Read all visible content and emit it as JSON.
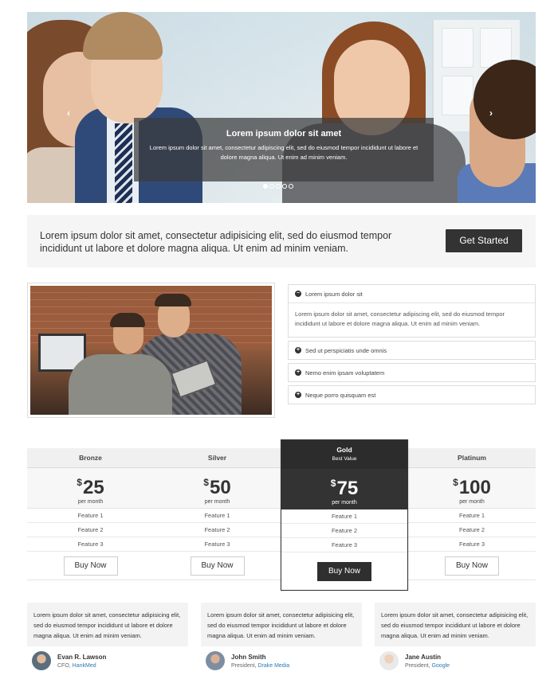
{
  "hero": {
    "caption_title": "Lorem ipsum dolor sit amet",
    "caption_text": "Lorem ipsum dolor sit amet, consectetur adipiscing elit, sed do eiusmod tempor incididunt ut labore et dolore magna aliqua. Ut enim ad minim veniam.",
    "prev_icon": "‹",
    "next_icon": "›",
    "slide_count": 5,
    "active_slide": 1
  },
  "callout": {
    "text": "Lorem ipsum dolor sit amet, consectetur adipisicing elit, sed do eiusmod tempor incididunt ut labore et dolore magna aliqua. Ut enim ad minim veniam.",
    "button_label": "Get Started"
  },
  "accordion": {
    "items": [
      {
        "title": "Lorem ipsum dolor sit",
        "icon": "−",
        "open": true,
        "body": "Lorem ipsum dolor sit amet, consectetur adipiscing elit, sed do eiusmod tempor incididunt ut labore et dolore magna aliqua. Ut enim ad minim veniam."
      },
      {
        "title": "Sed ut perspiciatis unde omnis",
        "icon": "+",
        "open": false
      },
      {
        "title": "Nemo enim ipsam voluptatem",
        "icon": "+",
        "open": false
      },
      {
        "title": "Neque porro quisquam est",
        "icon": "+",
        "open": false
      }
    ]
  },
  "pricing": {
    "plans": [
      {
        "name": "Bronze",
        "currency": "$",
        "amount": "25",
        "period": "per month",
        "features": [
          "Feature 1",
          "Feature 2",
          "Feature 3"
        ],
        "button": "Buy Now"
      },
      {
        "name": "Silver",
        "currency": "$",
        "amount": "50",
        "period": "per month",
        "features": [
          "Feature 1",
          "Feature 2",
          "Feature 3"
        ],
        "button": "Buy Now"
      },
      {
        "name": "Gold",
        "subtitle": "Best Value",
        "currency": "$",
        "amount": "75",
        "period": "per month",
        "features": [
          "Feature 1",
          "Feature 2",
          "Feature 3"
        ],
        "button": "Buy Now"
      },
      {
        "name": "Platinum",
        "currency": "$",
        "amount": "100",
        "period": "per month",
        "features": [
          "Feature 1",
          "Feature 2",
          "Feature 3"
        ],
        "button": "Buy Now"
      }
    ]
  },
  "testimonials": [
    {
      "quote": "Lorem ipsum dolor sit amet, consectetur adipisicing elit, sed do eiusmod tempor incididunt ut labore et dolore magna aliqua. Ut enim ad minim veniam.",
      "name": "Evan R. Lawson",
      "role": "CFO, ",
      "company": "HankMed",
      "avatar_color": "#5a6e7e"
    },
    {
      "quote": "Lorem ipsum dolor sit amet, consectetur adipisicing elit, sed do eiusmod tempor incididunt ut labore et dolore magna aliqua. Ut enim ad minim veniam.",
      "name": "John Smith",
      "role": "President, ",
      "company": "Drake Media",
      "avatar_color": "#7d8ea3"
    },
    {
      "quote": "Lorem ipsum dolor sit amet, consectetur adipisicing elit, sed do eiusmod tempor incididunt ut labore et dolore magna aliqua. Ut enim ad minim veniam.",
      "name": "Jane Austin",
      "role": "President, ",
      "company": "Google",
      "avatar_color": "#c9b7a8"
    }
  ],
  "colors": {
    "dark": "#333333",
    "link": "#2a7ab8",
    "panel": "#f5f5f5"
  }
}
